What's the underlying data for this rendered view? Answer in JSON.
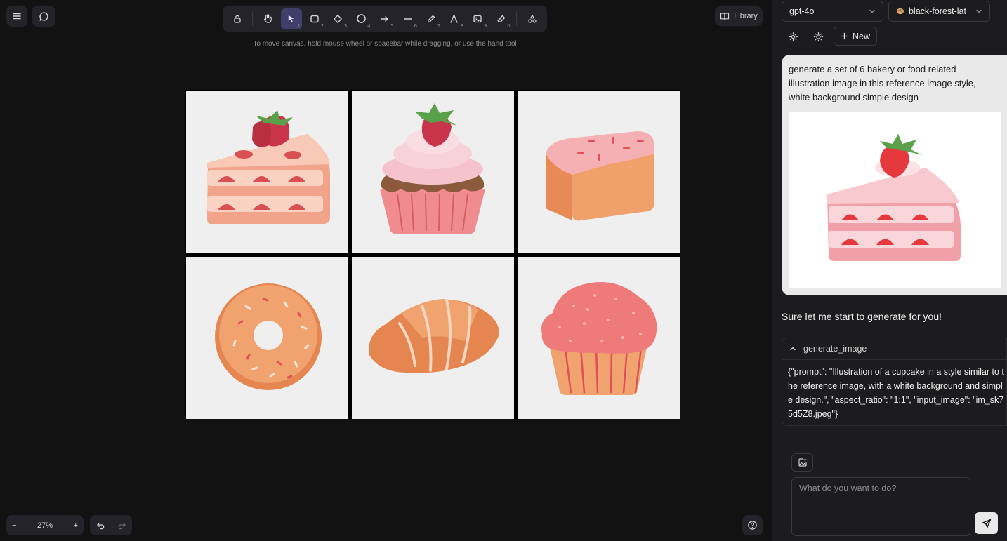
{
  "toolbar": {
    "tools": [
      {
        "id": "lock",
        "num": ""
      },
      {
        "id": "hand",
        "num": ""
      },
      {
        "id": "select",
        "num": "1"
      },
      {
        "id": "rectangle",
        "num": "2"
      },
      {
        "id": "diamond",
        "num": "3"
      },
      {
        "id": "ellipse",
        "num": "4"
      },
      {
        "id": "arrow",
        "num": "5"
      },
      {
        "id": "line",
        "num": "6"
      },
      {
        "id": "draw",
        "num": "7"
      },
      {
        "id": "text",
        "num": "8"
      },
      {
        "id": "image",
        "num": "9"
      },
      {
        "id": "eraser",
        "num": "0"
      },
      {
        "id": "more",
        "num": ""
      }
    ],
    "hint": "To move canvas, hold mouse wheel or spacebar while dragging, or use the hand tool"
  },
  "library_label": "Library",
  "zoom": {
    "level": "27%",
    "minus": "−",
    "plus": "+"
  },
  "panel": {
    "model_select": "gpt-4o",
    "image_model_select": "black-forest-lat",
    "new_label": "New",
    "user_message": "generate a set of 6 bakery or food related illustration image in this reference image style, white background simple design",
    "assistant_message": "Sure let me start to generate for you!",
    "tool_call": {
      "name": "generate_image",
      "args": "{\"prompt\": \"Illustration of a cupcake in a style similar to the reference image, with a white background and simple design.\", \"aspect_ratio\": \"1:1\", \"input_image\": \"im_sk75d5Z8.jpeg\"}"
    },
    "input_placeholder": "What do you want to do?"
  },
  "colors": {
    "accent": "#403e6a",
    "canvas": "#121212",
    "panel": "#1c1c1e",
    "tile": "#efefef"
  }
}
